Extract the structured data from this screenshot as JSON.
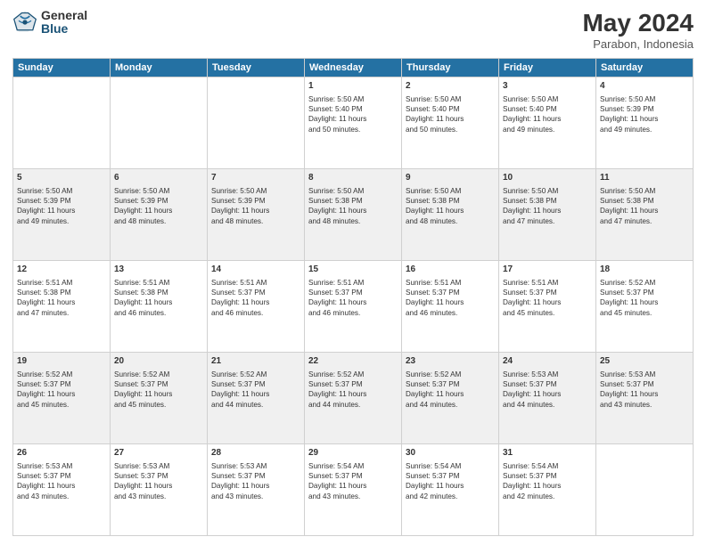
{
  "header": {
    "logo_general": "General",
    "logo_blue": "Blue",
    "month": "May 2024",
    "location": "Parabon, Indonesia"
  },
  "days_of_week": [
    "Sunday",
    "Monday",
    "Tuesday",
    "Wednesday",
    "Thursday",
    "Friday",
    "Saturday"
  ],
  "weeks": [
    [
      {
        "day": "",
        "info": ""
      },
      {
        "day": "",
        "info": ""
      },
      {
        "day": "",
        "info": ""
      },
      {
        "day": "1",
        "info": "Sunrise: 5:50 AM\nSunset: 5:40 PM\nDaylight: 11 hours\nand 50 minutes."
      },
      {
        "day": "2",
        "info": "Sunrise: 5:50 AM\nSunset: 5:40 PM\nDaylight: 11 hours\nand 50 minutes."
      },
      {
        "day": "3",
        "info": "Sunrise: 5:50 AM\nSunset: 5:40 PM\nDaylight: 11 hours\nand 49 minutes."
      },
      {
        "day": "4",
        "info": "Sunrise: 5:50 AM\nSunset: 5:39 PM\nDaylight: 11 hours\nand 49 minutes."
      }
    ],
    [
      {
        "day": "5",
        "info": "Sunrise: 5:50 AM\nSunset: 5:39 PM\nDaylight: 11 hours\nand 49 minutes."
      },
      {
        "day": "6",
        "info": "Sunrise: 5:50 AM\nSunset: 5:39 PM\nDaylight: 11 hours\nand 48 minutes."
      },
      {
        "day": "7",
        "info": "Sunrise: 5:50 AM\nSunset: 5:39 PM\nDaylight: 11 hours\nand 48 minutes."
      },
      {
        "day": "8",
        "info": "Sunrise: 5:50 AM\nSunset: 5:38 PM\nDaylight: 11 hours\nand 48 minutes."
      },
      {
        "day": "9",
        "info": "Sunrise: 5:50 AM\nSunset: 5:38 PM\nDaylight: 11 hours\nand 48 minutes."
      },
      {
        "day": "10",
        "info": "Sunrise: 5:50 AM\nSunset: 5:38 PM\nDaylight: 11 hours\nand 47 minutes."
      },
      {
        "day": "11",
        "info": "Sunrise: 5:50 AM\nSunset: 5:38 PM\nDaylight: 11 hours\nand 47 minutes."
      }
    ],
    [
      {
        "day": "12",
        "info": "Sunrise: 5:51 AM\nSunset: 5:38 PM\nDaylight: 11 hours\nand 47 minutes."
      },
      {
        "day": "13",
        "info": "Sunrise: 5:51 AM\nSunset: 5:38 PM\nDaylight: 11 hours\nand 46 minutes."
      },
      {
        "day": "14",
        "info": "Sunrise: 5:51 AM\nSunset: 5:37 PM\nDaylight: 11 hours\nand 46 minutes."
      },
      {
        "day": "15",
        "info": "Sunrise: 5:51 AM\nSunset: 5:37 PM\nDaylight: 11 hours\nand 46 minutes."
      },
      {
        "day": "16",
        "info": "Sunrise: 5:51 AM\nSunset: 5:37 PM\nDaylight: 11 hours\nand 46 minutes."
      },
      {
        "day": "17",
        "info": "Sunrise: 5:51 AM\nSunset: 5:37 PM\nDaylight: 11 hours\nand 45 minutes."
      },
      {
        "day": "18",
        "info": "Sunrise: 5:52 AM\nSunset: 5:37 PM\nDaylight: 11 hours\nand 45 minutes."
      }
    ],
    [
      {
        "day": "19",
        "info": "Sunrise: 5:52 AM\nSunset: 5:37 PM\nDaylight: 11 hours\nand 45 minutes."
      },
      {
        "day": "20",
        "info": "Sunrise: 5:52 AM\nSunset: 5:37 PM\nDaylight: 11 hours\nand 45 minutes."
      },
      {
        "day": "21",
        "info": "Sunrise: 5:52 AM\nSunset: 5:37 PM\nDaylight: 11 hours\nand 44 minutes."
      },
      {
        "day": "22",
        "info": "Sunrise: 5:52 AM\nSunset: 5:37 PM\nDaylight: 11 hours\nand 44 minutes."
      },
      {
        "day": "23",
        "info": "Sunrise: 5:52 AM\nSunset: 5:37 PM\nDaylight: 11 hours\nand 44 minutes."
      },
      {
        "day": "24",
        "info": "Sunrise: 5:53 AM\nSunset: 5:37 PM\nDaylight: 11 hours\nand 44 minutes."
      },
      {
        "day": "25",
        "info": "Sunrise: 5:53 AM\nSunset: 5:37 PM\nDaylight: 11 hours\nand 43 minutes."
      }
    ],
    [
      {
        "day": "26",
        "info": "Sunrise: 5:53 AM\nSunset: 5:37 PM\nDaylight: 11 hours\nand 43 minutes."
      },
      {
        "day": "27",
        "info": "Sunrise: 5:53 AM\nSunset: 5:37 PM\nDaylight: 11 hours\nand 43 minutes."
      },
      {
        "day": "28",
        "info": "Sunrise: 5:53 AM\nSunset: 5:37 PM\nDaylight: 11 hours\nand 43 minutes."
      },
      {
        "day": "29",
        "info": "Sunrise: 5:54 AM\nSunset: 5:37 PM\nDaylight: 11 hours\nand 43 minutes."
      },
      {
        "day": "30",
        "info": "Sunrise: 5:54 AM\nSunset: 5:37 PM\nDaylight: 11 hours\nand 42 minutes."
      },
      {
        "day": "31",
        "info": "Sunrise: 5:54 AM\nSunset: 5:37 PM\nDaylight: 11 hours\nand 42 minutes."
      },
      {
        "day": "",
        "info": ""
      }
    ]
  ]
}
